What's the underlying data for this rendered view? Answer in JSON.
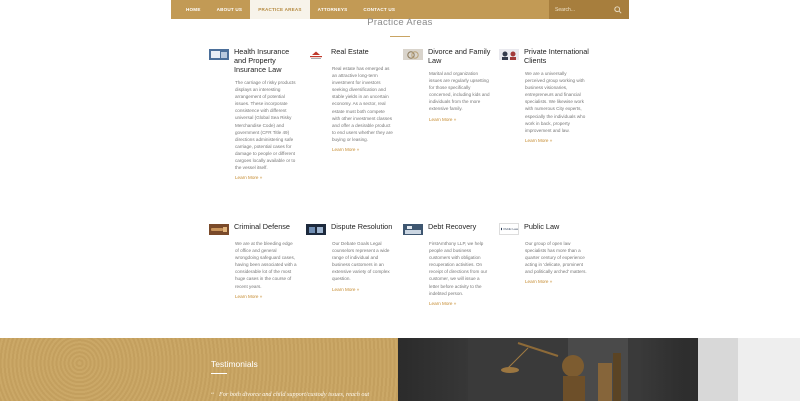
{
  "nav": {
    "items": [
      "HOME",
      "ABOUT US",
      "PRACTICE AREAS",
      "ATTORNEYS",
      "CONTACT US"
    ],
    "active_index": 2
  },
  "search": {
    "placeholder": "Search...",
    "icon": "search-icon"
  },
  "section": {
    "title": "Practice Areas"
  },
  "cards": [
    {
      "title": "Health Insurance and Property Insurance Law",
      "body": "The carriage of risky products displays an interesting arrangement of potential issues. These incorporate consistence with different universal (Global Sea Risky Merchandise Code) and government (CFR Title 49) directions administering safe carriage, potential cases for damage to people or different cargoes locally available or to the vessel itself.",
      "more": "Learn More »",
      "icon": "health-insurance-thumbnail"
    },
    {
      "title": "Real Estate",
      "body": "Real estate has emerged as an attractive long-term investment for investors seeking diversification and stable yields in an uncertain economy. As a sector, real estate must both compete with other investment classes and offer a desirable product to end users whether they are buying or leasing.",
      "more": "Learn More »",
      "icon": "real-estate-logo"
    },
    {
      "title": "Divorce and Family Law",
      "body": "Marital and organization issues are regularly upsetting for those specifically concerned, including kids and individuals from the more extensive family.",
      "more": "Learn More »",
      "icon": "divorce-family-thumbnail"
    },
    {
      "title": "Private International Clients",
      "body": "We are a universally perceived group working with business visionaries, entrepreneurs and financial specialists. We likewise work with numerous City experts, especially the individuals who work in back, property improvement and law.",
      "more": "Learn More »",
      "icon": "private-clients-thumbnail"
    },
    {
      "title": "Criminal Defense",
      "body": "We are at the bleeding edge of office and general wrongdoing safeguard cases, having been associated with a considerable lot of the most huge cases in the course of recent years.",
      "more": "Learn More »",
      "icon": "criminal-defense-thumbnail"
    },
    {
      "title": "Dispute Resolution",
      "body": "Our Debate Goals Legal counselors represent a wide range of individual and business customers in an extensive variety of complex question.",
      "more": "Learn More »",
      "icon": "dispute-resolution-thumbnail"
    },
    {
      "title": "Debt Recovery",
      "body": "FirstAmthony LLP, we help people and business customers with obligation recuperation activities. On receipt of directions from our customer, we will issue a letter before activity to the indebted person.",
      "more": "Learn More »",
      "icon": "debt-recovery-thumbnail"
    },
    {
      "title": "Public Law",
      "body": "Our group of open law specialists has more than a quarter century of experience acting in 'delicate, prominent and politically arched' matters.",
      "more": "Learn More »",
      "icon": "public-law-thumbnail",
      "thumb_text": "Public Law"
    }
  ],
  "testimonials": {
    "title": "Testimonials",
    "quote": "For both divorce and child support/custody issues, reach out"
  },
  "colors": {
    "brand_gold": "#c29a55",
    "link": "#c58a2e",
    "testimonials_bg": "#c9a461"
  }
}
